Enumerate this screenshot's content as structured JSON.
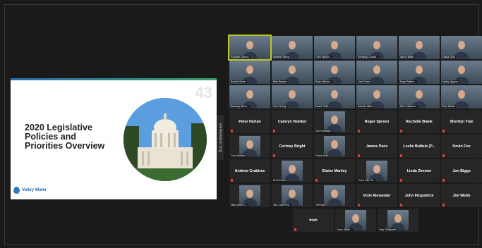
{
  "slide": {
    "number": "43",
    "title": "2020 Legislative Policies and Priorities Overview",
    "logo_text": "Valley Water",
    "side_tab": "valleywater.org"
  },
  "participants": [
    {
      "name": "Rachael Gibson",
      "video": true,
      "active": true
    },
    {
      "name": "Heather Hamp",
      "video": true
    },
    {
      "name": "Orrin Mahon...",
      "video": true
    },
    {
      "name": "Domingo Canda...",
      "video": true
    },
    {
      "name": "Aaron Baker",
      "video": true
    },
    {
      "name": "Diana Gels",
      "video": true
    },
    {
      "name": "Beckie Zisser",
      "video": true
    },
    {
      "name": "Bart Broome",
      "video": true
    },
    {
      "name": "Brian Mende...",
      "video": true
    },
    {
      "name": "Lisa Floren",
      "video": true
    },
    {
      "name": "Mary Patters...",
      "video": true
    },
    {
      "name": "Kathy Nguyen",
      "video": true
    },
    {
      "name": "Bethany Mess...",
      "video": true
    },
    {
      "name": "Lisa Chung",
      "video": true
    },
    {
      "name": "David Tuttle",
      "video": true
    },
    {
      "name": "Antonio Alfaro",
      "video": true
    },
    {
      "name": "Rick Callendo...",
      "video": true
    },
    {
      "name": "Rao Meloni",
      "video": true
    },
    {
      "name": "Peter Hertan",
      "video": false
    },
    {
      "name": "Camryn Heinkel",
      "video": false
    },
    {
      "name": "Zoe Karrasan",
      "video": true
    },
    {
      "name": "Roger Spreen",
      "video": false
    },
    {
      "name": "Rechelle Blank",
      "video": false
    },
    {
      "name": "Sherilyn Tran",
      "video": false
    },
    {
      "name": "Gina Adriano",
      "video": true
    },
    {
      "name": "Cortney Bright",
      "video": false
    },
    {
      "name": "David Arnio",
      "video": true
    },
    {
      "name": "James Pace",
      "video": false
    },
    {
      "name": "Leslie Bulbuk (P...",
      "video": false
    },
    {
      "name": "Kevin Fox",
      "video": false
    },
    {
      "name": "Andrew Crabtree",
      "video": false
    },
    {
      "name": "Ruth Elbert",
      "video": true
    },
    {
      "name": "Elaine Manley",
      "video": false
    },
    {
      "name": "Frank e5p Re...",
      "video": true
    },
    {
      "name": "Linda Zimmer",
      "video": false
    },
    {
      "name": "Jon Biggs",
      "video": false
    },
    {
      "name": "Mary Anne D...",
      "video": true
    },
    {
      "name": "San Jose Res...",
      "video": true
    },
    {
      "name": "Jeff Mize",
      "video": true
    },
    {
      "name": "Vicki Alexander",
      "video": false
    },
    {
      "name": "John Fitzpatrick",
      "video": false
    },
    {
      "name": "Jim Webb",
      "video": false
    },
    {
      "name": "trish",
      "video": false
    },
    {
      "name": "Dawn Mahe...",
      "video": true
    },
    {
      "name": "Katy Fitzgerald",
      "video": true
    }
  ],
  "colors": {
    "background": "#1a1a1a",
    "tile": "#262626",
    "active_speaker": "#b7c62b",
    "mic_muted": "#e53e3e"
  }
}
